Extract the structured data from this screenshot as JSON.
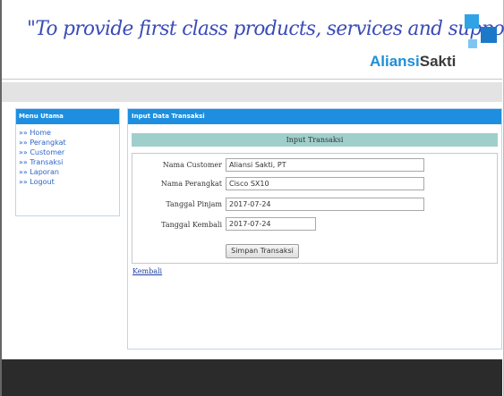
{
  "header": {
    "tagline": "\"To provide first class products, services and support\"",
    "brand_part1": "Aliansi",
    "brand_part2": "Sakti"
  },
  "sidebar": {
    "title": "Menu Utama",
    "items": [
      {
        "label": "»» Home"
      },
      {
        "label": "»» Perangkat"
      },
      {
        "label": "»» Customer"
      },
      {
        "label": "»» Transaksi"
      },
      {
        "label": "»» Laporan"
      },
      {
        "label": "»» Logout"
      }
    ]
  },
  "main": {
    "title": "Input Data Transaksi",
    "form_title": "Input Transaksi",
    "fields": [
      {
        "label": "Nama Customer",
        "value": "Aliansi Sakti, PT"
      },
      {
        "label": "Nama Perangkat",
        "value": "Cisco SX10"
      },
      {
        "label": "Tanggal Pinjam",
        "value": "2017-07-24"
      },
      {
        "label": "Tanggal Kembali",
        "value": "2017-07-24"
      }
    ],
    "submit_label": "Simpan Transaksi",
    "back_link": "Kembali"
  },
  "colors": {
    "accent": "#1e8fe0",
    "form_title_bg": "#9fcfcb",
    "footer": "#2b2b2b"
  }
}
